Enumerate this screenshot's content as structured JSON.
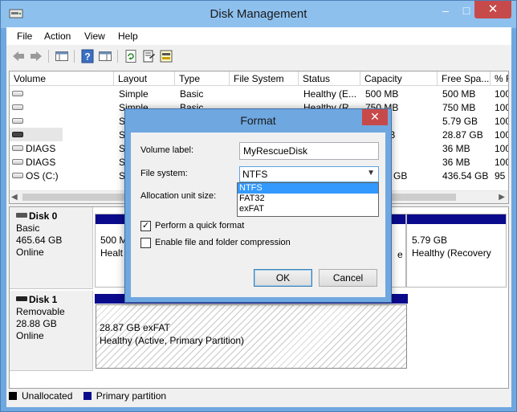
{
  "window": {
    "title": "Disk Management",
    "minimize_glyph": "–",
    "maximize_glyph": "□",
    "close_glyph": "✕"
  },
  "menu": [
    "File",
    "Action",
    "View",
    "Help"
  ],
  "toolbar_icons": [
    "back-icon",
    "forward-icon",
    "show-hide-console-tree-icon",
    "help-icon",
    "show-hide-action-pane-icon",
    "refresh-icon",
    "properties-icon",
    "rescan-disks-icon"
  ],
  "volume_table": {
    "headers": [
      "Volume",
      "Layout",
      "Type",
      "File System",
      "Status",
      "Capacity",
      "Free Spa...",
      "% F"
    ],
    "rows": [
      [
        "",
        "Simple",
        "Basic",
        "",
        "Healthy (E...",
        "500 MB",
        "500 MB",
        "100"
      ],
      [
        "",
        "Simple",
        "Basic",
        "",
        "Healthy (R...",
        "750 MB",
        "750 MB",
        "100"
      ],
      [
        "",
        "Si",
        "",
        "",
        "",
        "",
        "5.79 GB",
        "100"
      ],
      [
        "",
        "Si",
        "",
        "",
        "",
        "GB",
        "28.87 GB",
        "100"
      ],
      [
        "DIAGS",
        "Si",
        "",
        "",
        "",
        "",
        "36 MB",
        "100"
      ],
      [
        "DIAGS",
        "Si",
        "",
        "",
        "",
        "",
        "36 MB",
        "100"
      ],
      [
        "OS (C:)",
        "Si",
        "",
        "",
        "",
        "GB",
        "436.54 GB",
        "95"
      ]
    ]
  },
  "disks": [
    {
      "name": "Disk 0",
      "type": "Basic",
      "size": "465.64 GB",
      "state": "Online",
      "partitions": [
        {
          "size": "500 M",
          "status": "Healt"
        },
        {
          "size": "5.79 GB",
          "status": "Healthy (Recovery"
        }
      ],
      "middle_fragment": "e"
    },
    {
      "name": "Disk 1",
      "type": "Removable",
      "size": "28.88 GB",
      "state": "Online",
      "partitions": [
        {
          "size": "28.87 GB exFAT",
          "status": "Healthy (Active, Primary Partition)"
        }
      ]
    }
  ],
  "legend": [
    {
      "label": "Unallocated",
      "color": "#000000"
    },
    {
      "label": "Primary partition",
      "color": "#0a0a8c"
    }
  ],
  "format_dialog": {
    "title": "Format",
    "volume_label_caption": "Volume label:",
    "volume_label_value": "MyRescueDisk",
    "file_system_caption": "File system:",
    "file_system_value": "NTFS",
    "file_system_options": [
      "NTFS",
      "FAT32",
      "exFAT"
    ],
    "allocation_caption": "Allocation unit size:",
    "quick_format_label": "Perform a quick format",
    "quick_format_checked": true,
    "compression_label": "Enable file and folder compression",
    "compression_checked": false,
    "ok_label": "OK",
    "cancel_label": "Cancel"
  }
}
